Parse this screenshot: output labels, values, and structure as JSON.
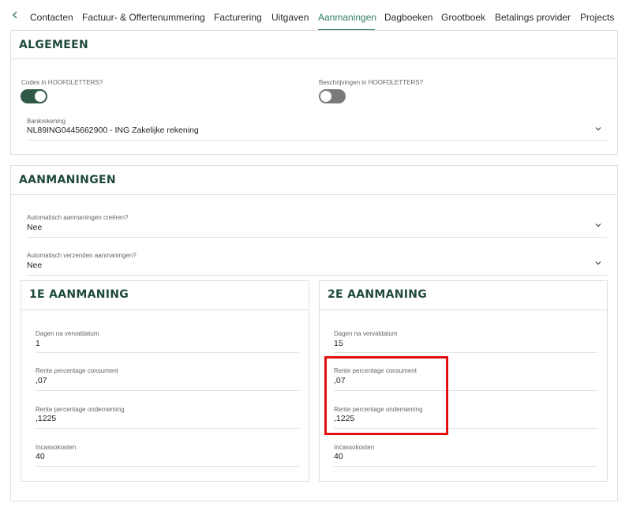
{
  "tabs": [
    {
      "label": "Contacten",
      "active": false
    },
    {
      "label": "Factuur- & Offertenummering",
      "active": false
    },
    {
      "label": "Facturering",
      "active": false
    },
    {
      "label": "Uitgaven",
      "active": false
    },
    {
      "label": "Aanmaningen",
      "active": true
    },
    {
      "label": "Dagboeken",
      "active": false
    },
    {
      "label": "Grootboek",
      "active": false
    },
    {
      "label": "Betalings provider",
      "active": false
    },
    {
      "label": "Projects",
      "active": false
    }
  ],
  "algemeen": {
    "title": "ALGEMEEN",
    "codes_label": "Codes in HOOFDLETTERS?",
    "codes_on": true,
    "beschrijvingen_label": "Beschrijvingen in HOOFDLETTERS?",
    "beschrijvingen_on": false,
    "bank_label": "Bankrekening",
    "bank_value": "NL89ING0445662900 - ING Zakelijke rekening"
  },
  "aanmaningen": {
    "title": "AANMANINGEN",
    "auto_create_label": "Automatisch aanmaningen creëren?",
    "auto_create_value": "Nee",
    "auto_send_label": "Automatisch verzenden aanmaningen?",
    "auto_send_value": "Nee"
  },
  "first_reminder": {
    "title": "1E AANMANING",
    "dagen_label": "Dagen na vervaldatum",
    "dagen_value": "1",
    "rente_consument_label": "Rente percentage consument",
    "rente_consument_value": ",07",
    "rente_onderneming_label": "Rente percentage onderneming",
    "rente_onderneming_value": ",1225",
    "incasso_label": "Incassokosten",
    "incasso_value": "40"
  },
  "second_reminder": {
    "title": "2E AANMANING",
    "dagen_label": "Dagen na vervaldatum",
    "dagen_value": "15",
    "rente_consument_label": "Rente percentage consument",
    "rente_consument_value": ",07",
    "rente_onderneming_label": "Rente percentage onderneming",
    "rente_onderneming_value": ",1225",
    "incasso_label": "Incassokosten",
    "incasso_value": "40"
  },
  "colors": {
    "accent": "#2e7d5b",
    "title_green": "#1f4a3a",
    "toggle_on": "#2e5a45",
    "toggle_off": "#7a7a7a",
    "highlight": "#e10e0e"
  }
}
